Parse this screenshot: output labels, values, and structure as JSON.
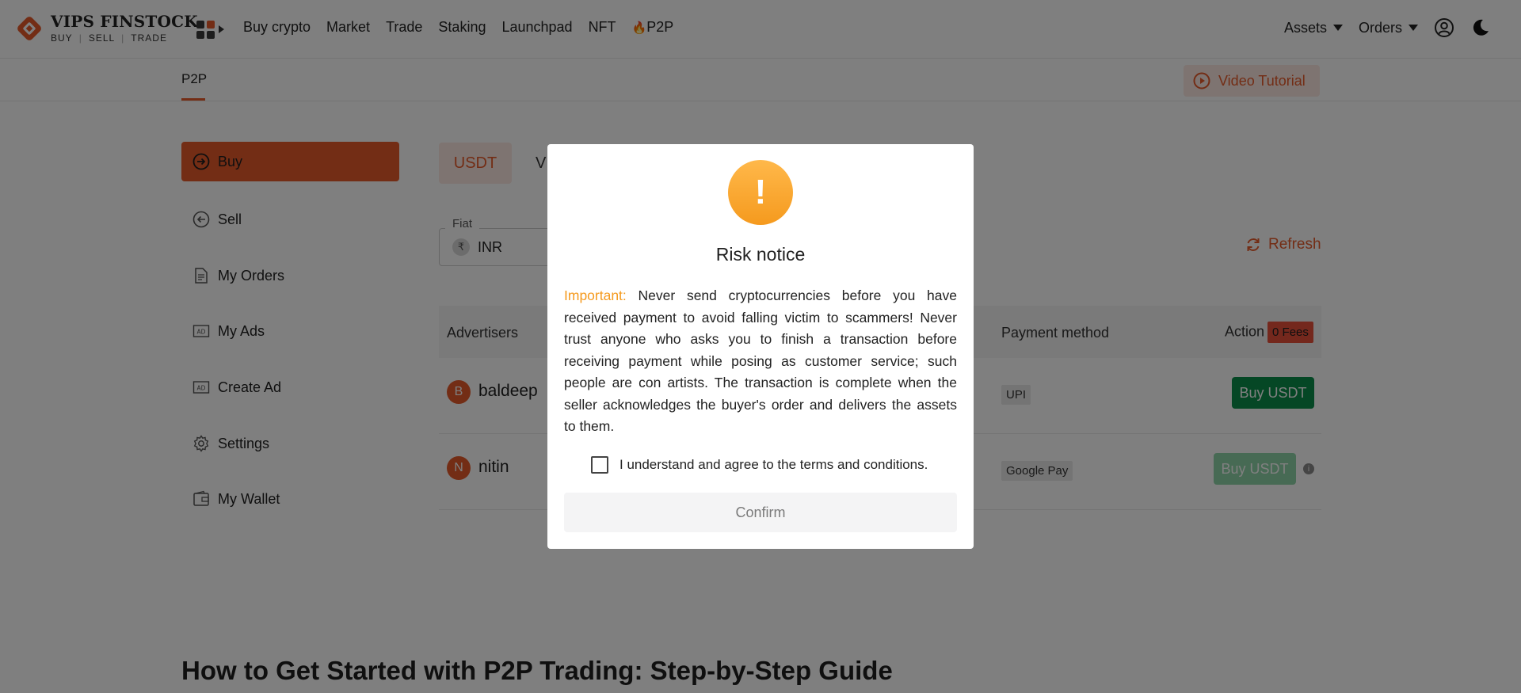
{
  "header": {
    "logo_title": "VIPS FINSTOCK",
    "logo_sub": [
      "BUY",
      "SELL",
      "TRADE"
    ],
    "nav": [
      "Buy crypto",
      "Market",
      "Trade",
      "Staking",
      "Launchpad",
      "NFT",
      "P2P"
    ],
    "assets_label": "Assets",
    "orders_label": "Orders",
    "brand_color": "#e65a2b"
  },
  "subbar": {
    "tab": "P2P",
    "video_tutorial": "Video Tutorial"
  },
  "sidebar": {
    "items": [
      {
        "label": "Buy",
        "icon": "arrow-right-circle-icon",
        "active": true
      },
      {
        "label": "Sell",
        "icon": "arrow-left-circle-icon"
      },
      {
        "label": "My Orders",
        "icon": "document-icon"
      },
      {
        "label": "My Ads",
        "icon": "ad-icon"
      },
      {
        "label": "Create Ad",
        "icon": "ad-icon"
      },
      {
        "label": "Settings",
        "icon": "gear-icon"
      },
      {
        "label": "My Wallet",
        "icon": "wallet-icon"
      }
    ]
  },
  "main": {
    "coin_tabs": [
      "USDT",
      "V"
    ],
    "fiat_label": "Fiat",
    "fiat_value": "INR",
    "fiat_symbol": "₹",
    "refresh_label": "Refresh",
    "table": {
      "headers": {
        "advertisers": "Advertisers",
        "payment": "Payment method",
        "action": "Action",
        "fees_badge": "0 Fees"
      },
      "rows": [
        {
          "initial": "B",
          "name": "baldeep",
          "payment": "UPI",
          "button": "Buy USDT",
          "enabled": true
        },
        {
          "initial": "N",
          "name": "nitin",
          "payment": "Google Pay",
          "button": "Buy USDT",
          "enabled": false
        }
      ]
    },
    "guide_title": "How to Get Started with P2P Trading: Step-by-Step Guide"
  },
  "modal": {
    "icon_glyph": "!",
    "title": "Risk notice",
    "important_label": "Important:",
    "body": " Never send cryptocurrencies before you have received payment to avoid falling victim to scammers! Never trust anyone who asks you to finish a transaction before receiving payment while posing as customer service; such people are con artists. The transaction is complete when the seller acknowledges the buyer's order and delivers the assets to them.",
    "agree_text": "I understand and agree to the terms and conditions.",
    "agree_checked": false,
    "confirm_label": "Confirm"
  }
}
